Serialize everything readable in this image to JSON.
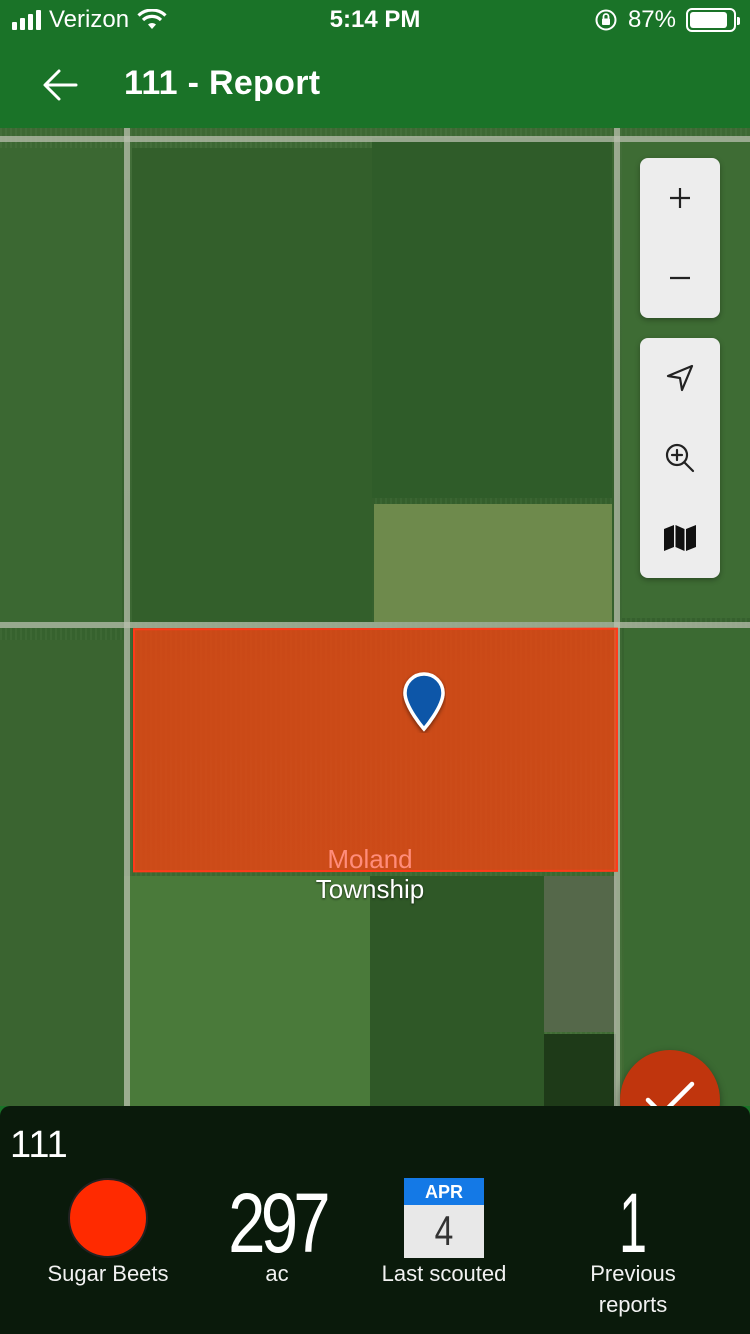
{
  "status_bar": {
    "carrier": "Verizon",
    "time": "5:14 PM",
    "battery": "87%",
    "battery_level": 0.87
  },
  "header": {
    "title": "111 - Report",
    "back_icon": "arrow-left-icon"
  },
  "map": {
    "labels": [
      "Moland",
      "Township"
    ],
    "field_color": "#eb4412",
    "pin_color": "#0a56a8",
    "controls": {
      "zoom_in_icon": "plus-icon",
      "zoom_out_icon": "minus-icon",
      "locate_icon": "navigation-arrow-icon",
      "zoom_to_field_icon": "zoom-in-magnifier-icon",
      "map_layers_icon": "map-icon"
    }
  },
  "panel": {
    "field_name": "111",
    "crop": "Sugar Beets",
    "crop_color": "#ff2a00",
    "acres": "297",
    "acres_unit": "ac",
    "last_scouted_month": "APR",
    "last_scouted_day": "4",
    "last_scouted_label": "Last scouted",
    "previous_reports_count": "1",
    "previous_reports_label_1": "Previous",
    "previous_reports_label_2": "reports"
  },
  "fab": {
    "icon": "checkmark-icon",
    "color": "#c0350d"
  }
}
